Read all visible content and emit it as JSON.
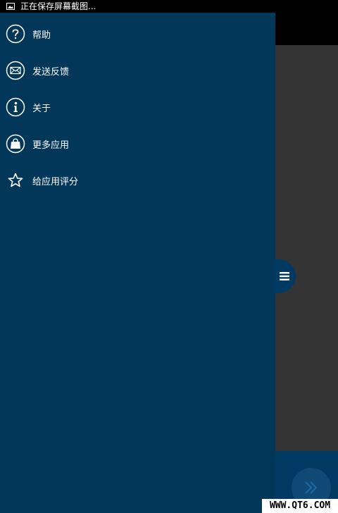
{
  "status_bar": {
    "icon": "image-icon",
    "text": "正在保存屏幕截图..."
  },
  "drawer": {
    "items": [
      {
        "label": "帮助",
        "icon": "help-icon"
      },
      {
        "label": "发送反馈",
        "icon": "mail-icon"
      },
      {
        "label": "关于",
        "icon": "info-icon"
      },
      {
        "label": "更多应用",
        "icon": "shopping-bag-icon"
      },
      {
        "label": "给应用评分",
        "icon": "star-icon"
      }
    ],
    "handle_icon": "menu-icon"
  },
  "background_app": {
    "action_icon": "chevron-double-right-icon"
  },
  "watermark": "WWW.QT6.COM",
  "colors": {
    "drawer_bg": "#03375a",
    "content_bg": "#343434",
    "bottom_bar_bg": "#003a62",
    "status_bar_bg": "#000000"
  }
}
